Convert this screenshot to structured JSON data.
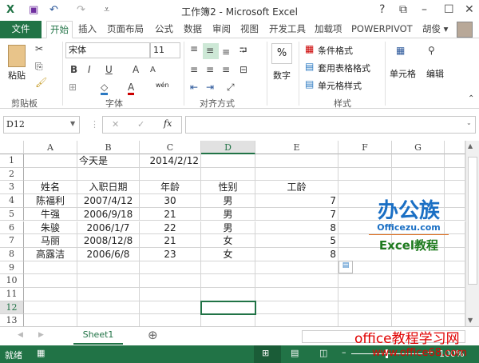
{
  "window": {
    "title": "工作簿2 - Microsoft Excel",
    "help": "?",
    "restore": "⧉",
    "minimize": "–",
    "maximize": "☐",
    "close": "✕"
  },
  "quick_access": {
    "excel_icon": "X",
    "save": "💾",
    "undo": "↶",
    "redo": "↷",
    "customize": "⩡"
  },
  "tabs": {
    "file": "文件",
    "items": [
      "开始",
      "插入",
      "页面布局",
      "公式",
      "数据",
      "审阅",
      "视图",
      "开发工具",
      "加载项",
      "POWERPIVOT"
    ],
    "user": "胡俊 ▾"
  },
  "ribbon": {
    "clipboard": {
      "paste": "粘贴",
      "label": "剪贴板"
    },
    "font": {
      "name": "宋体",
      "size": "11",
      "bold": "B",
      "italic": "I",
      "underline": "U",
      "grow": "A",
      "shrink": "A",
      "color": "A",
      "phonetic": "wén",
      "label": "字体"
    },
    "alignment": {
      "label": "对齐方式"
    },
    "number": {
      "symbol": "%",
      "label": "数字"
    },
    "styles": {
      "conditional": "条件格式",
      "table": "套用表格格式",
      "cell": "单元格样式",
      "label": "样式"
    },
    "cells": {
      "label": "单元格"
    },
    "editing": {
      "label": "编辑"
    }
  },
  "formula_bar": {
    "name_box": "D12",
    "cancel": "✕",
    "enter": "✓",
    "fx": "fx",
    "value": ""
  },
  "columns": [
    "A",
    "B",
    "C",
    "D",
    "E",
    "F",
    "G"
  ],
  "rows": [
    "1",
    "2",
    "3",
    "4",
    "5",
    "6",
    "7",
    "8",
    "9",
    "10",
    "11",
    "12",
    "13"
  ],
  "selected_cell": "D12",
  "cells": [
    [
      "",
      "今天是",
      "2014/2/12",
      "",
      "",
      "",
      ""
    ],
    [
      "",
      "",
      "",
      "",
      "",
      "",
      ""
    ],
    [
      "姓名",
      "入职日期",
      "年龄",
      "性别",
      "工龄",
      "",
      ""
    ],
    [
      "陈福利",
      "2007/4/12",
      "30",
      "男",
      "7",
      "",
      ""
    ],
    [
      "牛强",
      "2006/9/18",
      "21",
      "男",
      "7",
      "",
      ""
    ],
    [
      "朱骏",
      "2006/1/7",
      "22",
      "男",
      "8",
      "",
      ""
    ],
    [
      "马丽",
      "2008/12/8",
      "21",
      "女",
      "5",
      "",
      ""
    ],
    [
      "高露洁",
      "2006/6/8",
      "23",
      "女",
      "8",
      "",
      ""
    ]
  ],
  "watermarks": {
    "logo": "办公族",
    "site": "Officezu.com",
    "excel": "Excel教程",
    "bottom1": "office教程学习网",
    "bottom2": "www.office68.com"
  },
  "sheets": [
    "Sheet1"
  ],
  "status": {
    "ready": "就绪",
    "zoom": "100%"
  },
  "colors": {
    "accent": "#217346"
  }
}
